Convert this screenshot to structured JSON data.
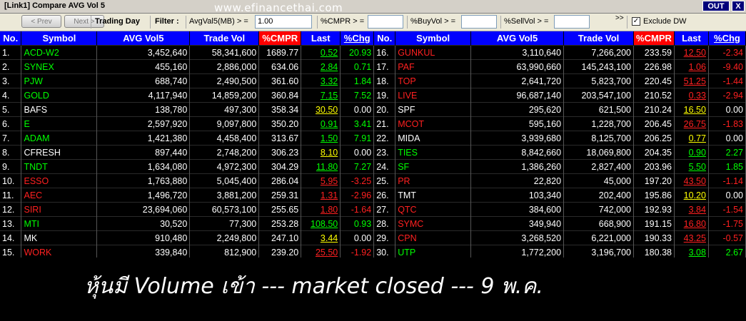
{
  "window": {
    "title": "[Link1] Compare AVG Vol 5",
    "watermark": "www.efinancethai.com",
    "out_label": "OUT",
    "close_label": "X"
  },
  "toolbar": {
    "prev_label": "< Prev",
    "next_label": "Next >",
    "trading_day": "Trading Day",
    "filter_label": "Filter :",
    "avg_label": "AvgVal5(MB) > =",
    "avg_value": "1.00",
    "cmpr_label": "%CMPR > =",
    "cmpr_value": "",
    "buyvol_label": "%BuyVol > =",
    "buyvol_value": "",
    "sellvol_label": "%SellVol > =",
    "sellvol_value": "",
    "overflow_icon": ">>",
    "exclude_label": "Exclude DW",
    "exclude_checked": true
  },
  "columns": [
    "No.",
    "Symbol",
    "AVG Vol5",
    "Trade Vol",
    "%CMPR",
    "Last",
    "%Chg"
  ],
  "rows_left": [
    {
      "no": "1.",
      "symbol": "ACD-W2",
      "avg": "3,452,640",
      "trade": "58,341,600",
      "cmpr": "1689.77",
      "last": "0.52",
      "chg": "20.93",
      "c": "g"
    },
    {
      "no": "2.",
      "symbol": "SYNEX",
      "avg": "455,160",
      "trade": "2,886,000",
      "cmpr": "634.06",
      "last": "2.84",
      "chg": "0.71",
      "c": "g"
    },
    {
      "no": "3.",
      "symbol": "PJW",
      "avg": "688,740",
      "trade": "2,490,500",
      "cmpr": "361.60",
      "last": "3.32",
      "chg": "1.84",
      "c": "g"
    },
    {
      "no": "4.",
      "symbol": "GOLD",
      "avg": "4,117,940",
      "trade": "14,859,200",
      "cmpr": "360.84",
      "last": "7.15",
      "chg": "7.52",
      "c": "g"
    },
    {
      "no": "5.",
      "symbol": "BAFS",
      "avg": "138,780",
      "trade": "497,300",
      "cmpr": "358.34",
      "last": "30.50",
      "chg": "0.00",
      "c": "y"
    },
    {
      "no": "6.",
      "symbol": "E",
      "avg": "2,597,920",
      "trade": "9,097,800",
      "cmpr": "350.20",
      "last": "0.91",
      "chg": "3.41",
      "c": "g"
    },
    {
      "no": "7.",
      "symbol": "ADAM",
      "avg": "1,421,380",
      "trade": "4,458,400",
      "cmpr": "313.67",
      "last": "1.50",
      "chg": "7.91",
      "c": "g"
    },
    {
      "no": "8.",
      "symbol": "CFRESH",
      "avg": "897,440",
      "trade": "2,748,200",
      "cmpr": "306.23",
      "last": "8.10",
      "chg": "0.00",
      "c": "y"
    },
    {
      "no": "9.",
      "symbol": "TNDT",
      "avg": "1,634,080",
      "trade": "4,972,300",
      "cmpr": "304.29",
      "last": "11.80",
      "chg": "7.27",
      "c": "g"
    },
    {
      "no": "10.",
      "symbol": "ESSO",
      "avg": "1,763,880",
      "trade": "5,045,400",
      "cmpr": "286.04",
      "last": "5.95",
      "chg": "-3.25",
      "c": "r"
    },
    {
      "no": "11.",
      "symbol": "AEC",
      "avg": "1,496,720",
      "trade": "3,881,200",
      "cmpr": "259.31",
      "last": "1.31",
      "chg": "-2.96",
      "c": "r"
    },
    {
      "no": "12.",
      "symbol": "SIRI",
      "avg": "23,694,060",
      "trade": "60,573,100",
      "cmpr": "255.65",
      "last": "1.80",
      "chg": "-1.64",
      "c": "r"
    },
    {
      "no": "13.",
      "symbol": "MTI",
      "avg": "30,520",
      "trade": "77,300",
      "cmpr": "253.28",
      "last": "108.50",
      "chg": "0.93",
      "c": "g"
    },
    {
      "no": "14.",
      "symbol": "MK",
      "avg": "910,480",
      "trade": "2,249,800",
      "cmpr": "247.10",
      "last": "3.44",
      "chg": "0.00",
      "c": "y"
    },
    {
      "no": "15.",
      "symbol": "WORK",
      "avg": "339,840",
      "trade": "812,900",
      "cmpr": "239.20",
      "last": "25.50",
      "chg": "-1.92",
      "c": "r"
    }
  ],
  "rows_right": [
    {
      "no": "16.",
      "symbol": "GUNKUL",
      "avg": "3,110,640",
      "trade": "7,266,200",
      "cmpr": "233.59",
      "last": "12.50",
      "chg": "-2.34",
      "c": "r"
    },
    {
      "no": "17.",
      "symbol": "PAF",
      "avg": "63,990,660",
      "trade": "145,243,100",
      "cmpr": "226.98",
      "last": "1.06",
      "chg": "-9.40",
      "c": "r"
    },
    {
      "no": "18.",
      "symbol": "TOP",
      "avg": "2,641,720",
      "trade": "5,823,700",
      "cmpr": "220.45",
      "last": "51.25",
      "chg": "-1.44",
      "c": "r"
    },
    {
      "no": "19.",
      "symbol": "LIVE",
      "avg": "96,687,140",
      "trade": "203,547,100",
      "cmpr": "210.52",
      "last": "0.33",
      "chg": "-2.94",
      "c": "r"
    },
    {
      "no": "20.",
      "symbol": "SPF",
      "avg": "295,620",
      "trade": "621,500",
      "cmpr": "210.24",
      "last": "16.50",
      "chg": "0.00",
      "c": "y"
    },
    {
      "no": "21.",
      "symbol": "MCOT",
      "avg": "595,160",
      "trade": "1,228,700",
      "cmpr": "206.45",
      "last": "26.75",
      "chg": "-1.83",
      "c": "r"
    },
    {
      "no": "22.",
      "symbol": "MIDA",
      "avg": "3,939,680",
      "trade": "8,125,700",
      "cmpr": "206.25",
      "last": "0.77",
      "chg": "0.00",
      "c": "y"
    },
    {
      "no": "23.",
      "symbol": "TIES",
      "avg": "8,842,660",
      "trade": "18,069,800",
      "cmpr": "204.35",
      "last": "0.90",
      "chg": "2.27",
      "c": "g"
    },
    {
      "no": "24.",
      "symbol": "SF",
      "avg": "1,386,260",
      "trade": "2,827,400",
      "cmpr": "203.96",
      "last": "5.50",
      "chg": "1.85",
      "c": "g"
    },
    {
      "no": "25.",
      "symbol": "PR",
      "avg": "22,820",
      "trade": "45,000",
      "cmpr": "197.20",
      "last": "43.50",
      "chg": "-1.14",
      "c": "r"
    },
    {
      "no": "26.",
      "symbol": "TMT",
      "avg": "103,340",
      "trade": "202,400",
      "cmpr": "195.86",
      "last": "10.20",
      "chg": "0.00",
      "c": "y"
    },
    {
      "no": "27.",
      "symbol": "QTC",
      "avg": "384,600",
      "trade": "742,000",
      "cmpr": "192.93",
      "last": "3.84",
      "chg": "-1.54",
      "c": "r"
    },
    {
      "no": "28.",
      "symbol": "SYMC",
      "avg": "349,940",
      "trade": "668,900",
      "cmpr": "191.15",
      "last": "16.80",
      "chg": "-1.75",
      "c": "r"
    },
    {
      "no": "29.",
      "symbol": "CPN",
      "avg": "3,268,520",
      "trade": "6,221,000",
      "cmpr": "190.33",
      "last": "43.25",
      "chg": "-0.57",
      "c": "r"
    },
    {
      "no": "30.",
      "symbol": "UTP",
      "avg": "1,772,200",
      "trade": "3,196,700",
      "cmpr": "180.38",
      "last": "3.08",
      "chg": "2.67",
      "c": "g"
    }
  ],
  "caption": "หุ้นมี Volume เข้า --- market closed --- 9 พ.ค."
}
